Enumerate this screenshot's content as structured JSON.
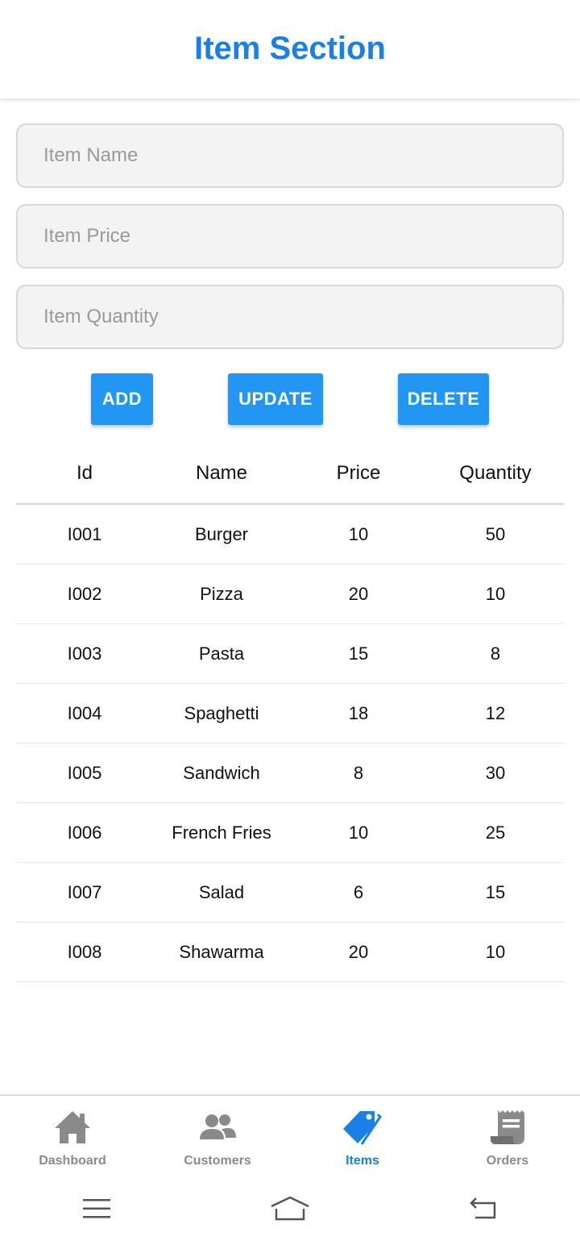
{
  "header": {
    "title": "Item Section"
  },
  "form": {
    "name_placeholder": "Item Name",
    "price_placeholder": "Item Price",
    "quantity_placeholder": "Item Quantity"
  },
  "actions": {
    "add": "ADD",
    "update": "UPDATE",
    "delete": "DELETE"
  },
  "table": {
    "columns": [
      "Id",
      "Name",
      "Price",
      "Quantity"
    ],
    "rows": [
      [
        "I001",
        "Burger",
        "10",
        "50"
      ],
      [
        "I002",
        "Pizza",
        "20",
        "10"
      ],
      [
        "I003",
        "Pasta",
        "15",
        "8"
      ],
      [
        "I004",
        "Spaghetti",
        "18",
        "12"
      ],
      [
        "I005",
        "Sandwich",
        "8",
        "30"
      ],
      [
        "I006",
        "French Fries",
        "10",
        "25"
      ],
      [
        "I007",
        "Salad",
        "6",
        "15"
      ],
      [
        "I008",
        "Shawarma",
        "20",
        "10"
      ]
    ]
  },
  "nav": {
    "items": [
      {
        "label": "Dashboard",
        "icon": "home-icon"
      },
      {
        "label": "Customers",
        "icon": "people-icon"
      },
      {
        "label": "Items",
        "icon": "tag-icon",
        "active": true
      },
      {
        "label": "Orders",
        "icon": "receipt-icon"
      }
    ]
  },
  "colors": {
    "accent": "#1a7fe6",
    "button": "#2196f3",
    "nav_inactive": "#8a8a8a"
  },
  "system_nav": {
    "icons": [
      "menu-icon",
      "home-outline-icon",
      "back-icon"
    ]
  }
}
